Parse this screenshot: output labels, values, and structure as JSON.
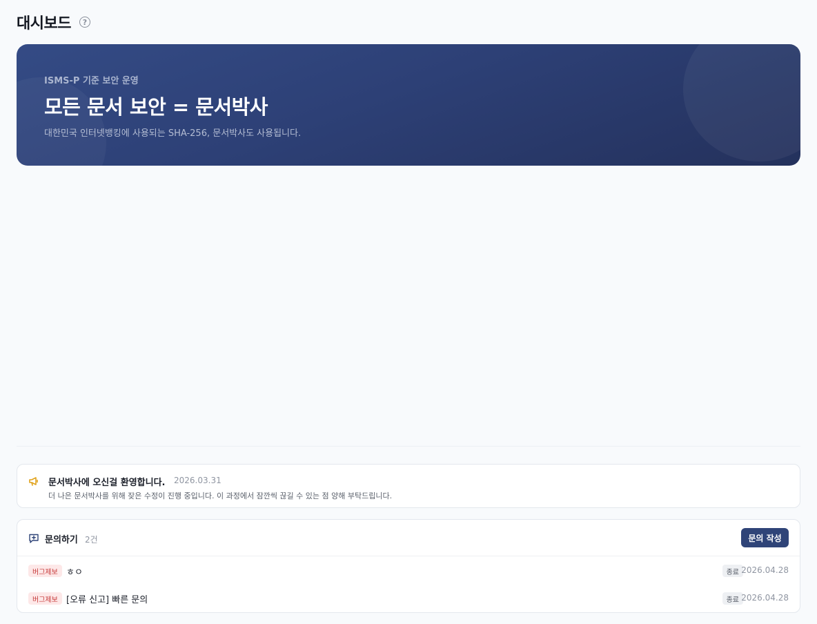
{
  "header": {
    "title": "대시보드",
    "help_icon": "question-circle-icon"
  },
  "hero": {
    "kicker": "ISMS-P 기준 보안 운영",
    "title": "모든 문서 보안 = 문서박사",
    "description": "대한민국 인터넷뱅킹에 사용되는 SHA-256, 문서박사도 사용됩니다."
  },
  "notice": {
    "icon": "megaphone-icon",
    "title": "문서박사에 오신걸 환영합니다.",
    "date": "2026.03.31",
    "body": "더 나은 문서박사를 위해 잦은 수정이 진행 중입니다. 이 과정에서 잠깐씩 끊길 수 있는 점 양해 부탁드립니다."
  },
  "inquiry": {
    "icon": "message-plus-icon",
    "title": "문의하기",
    "count": "2건",
    "write_button": "문의 작성",
    "rows": [
      {
        "tag": "버그제보",
        "title": "ㅎㅇ",
        "status": "종료",
        "date": "2026.04.28"
      },
      {
        "tag": "버그제보",
        "title": "[오류 신고] 빠른 문의",
        "status": "종료",
        "date": "2026.04.28"
      }
    ]
  },
  "colors": {
    "accent": "#2f4478",
    "tag_bg": "#fde8e8",
    "tag_text": "#c63a3a",
    "megaphone": "#e0a21a"
  }
}
